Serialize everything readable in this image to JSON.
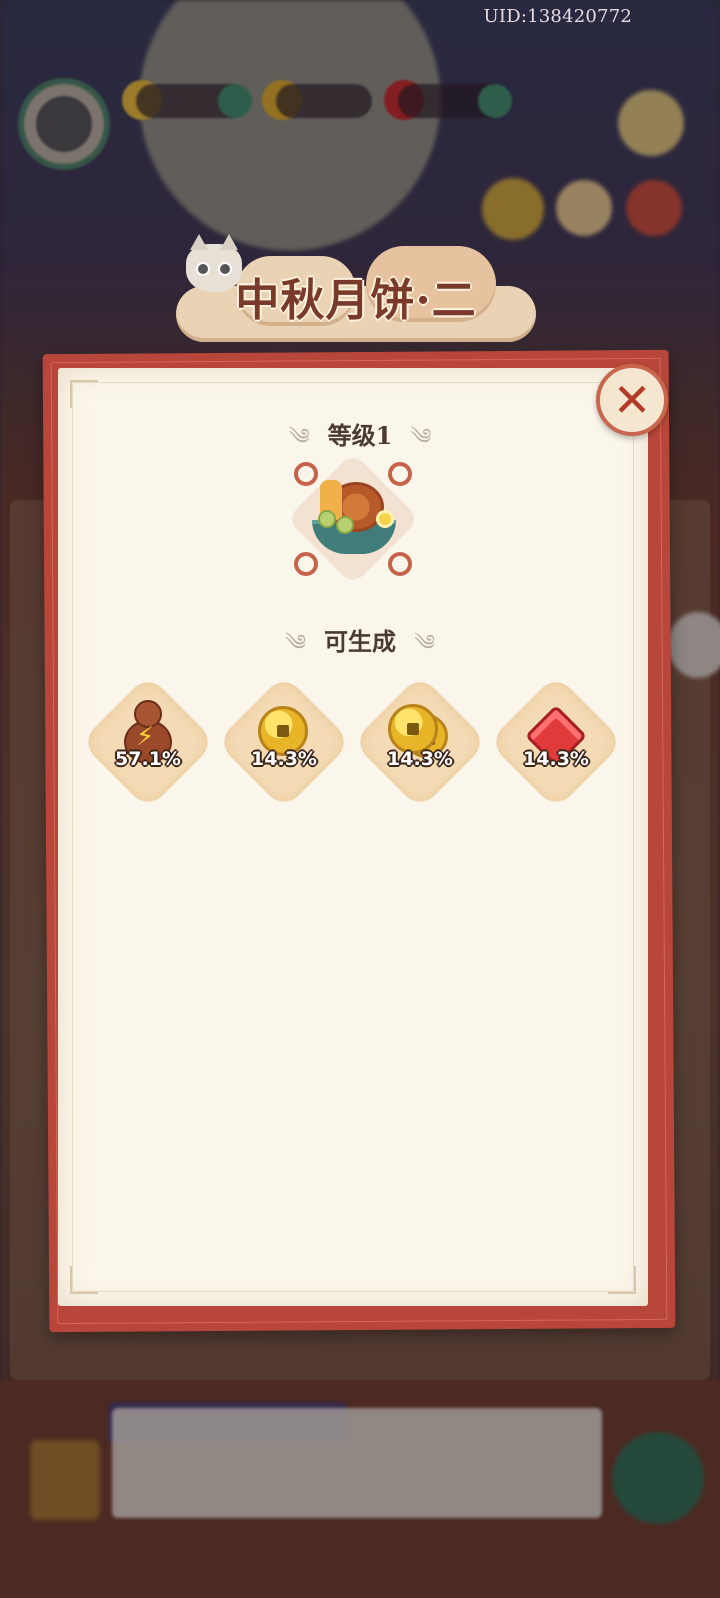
{
  "uid": "UID:138420772",
  "dialog": {
    "title": "中秋月饼·二",
    "level_label": "等级1",
    "produces_label": "可生成",
    "close_symbol": "✕"
  },
  "item": {
    "icon": "mooncake-bowl-icon"
  },
  "rewards": [
    {
      "icon": "energy-gourd-icon",
      "percent": "57.1%"
    },
    {
      "icon": "copper-coin-icon",
      "percent": "14.3%"
    },
    {
      "icon": "coin-stack-icon",
      "percent": "14.3%"
    },
    {
      "icon": "red-gem-icon",
      "percent": "14.3%"
    }
  ],
  "colors": {
    "panel_border": "#b8463a",
    "paper": "#fbf6ec",
    "title_text": "#7a3a2a",
    "close_accent": "#b43a28"
  }
}
